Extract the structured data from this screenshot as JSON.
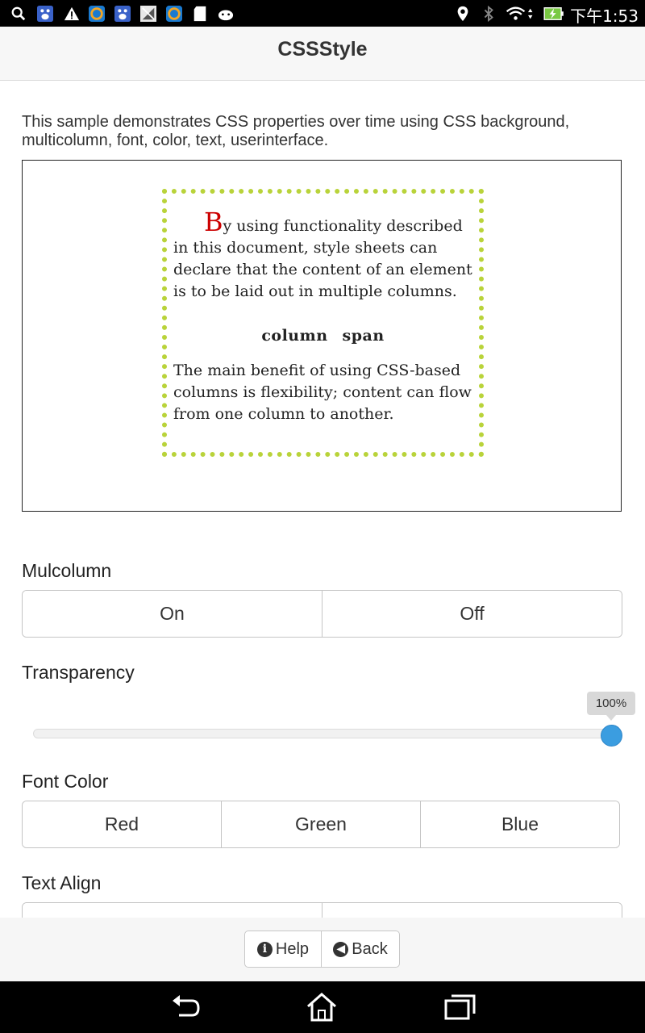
{
  "status_bar": {
    "time": "下午1:53",
    "icons": [
      "search-icon",
      "baidu-icon",
      "warning-icon",
      "browser-icon",
      "baidu-icon",
      "no-signal-icon",
      "browser-icon",
      "sd-card-icon",
      "android-icon",
      "location-icon",
      "bluetooth-icon",
      "wifi-icon",
      "battery-charging-icon"
    ]
  },
  "header": {
    "title": "CSSStyle"
  },
  "intro": "This sample demonstrates CSS properties over time using CSS background, multicolumn, font, color, text, userinterface.",
  "demo": {
    "drop_cap": "B",
    "para1_rest": "y using functionality described in this document, style sheets can declare that the content of an element is to be laid out in multiple columns.",
    "span_word1": "column",
    "span_word2": "span",
    "para2": "The main benefit of using CSS-based columns is flexibility; content can flow from one column to another."
  },
  "mulcolumn": {
    "label": "Mulcolumn",
    "options": [
      "On",
      "Off"
    ]
  },
  "transparency": {
    "label": "Transparency",
    "value_text": "100%",
    "value": 1.0
  },
  "font_color": {
    "label": "Font Color",
    "options": [
      "Red",
      "Green",
      "Blue"
    ]
  },
  "text_align": {
    "label": "Text Align"
  },
  "footer": {
    "help": "Help",
    "back": "Back"
  },
  "colors": {
    "accent": "#3b9de0",
    "border_dotted": "#b9d33a",
    "drop_cap": "#cc0000"
  }
}
